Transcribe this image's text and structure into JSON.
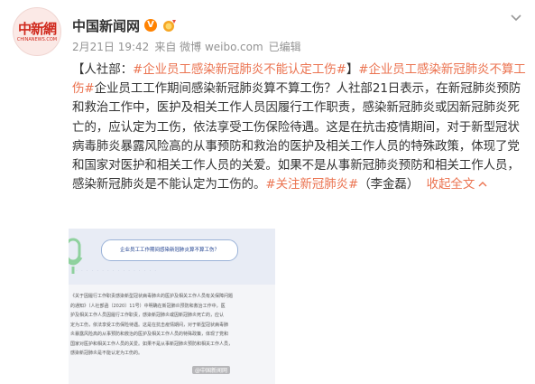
{
  "author": {
    "name": "中国新闻网",
    "avatar_text": "中新網",
    "avatar_subtext": "CHINANEWS.COM"
  },
  "meta": {
    "date": "2月21日 19:42",
    "source": "来自 微博 weibo.com",
    "edited": "已编辑"
  },
  "post": {
    "bracket_open": "【",
    "topic_label": "人社部：",
    "hashtag_1": "#企业员工感染新冠肺炎不能认定工伤#",
    "bracket_close": "】",
    "hashtag_2": "#企业员工感染新冠肺炎不算工伤#",
    "body": "企业员工工作期间感染新冠肺炎算不算工伤？人社部21日表示，在新冠肺炎预防和救治工作中，医护及相关工作人员因履行工作职责，感染新冠肺炎或因新冠肺炎死亡的，应认定为工伤，依法享受工伤保险待遇。这是在抗击疫情期间，对于新型冠状病毒肺炎暴露风险高的从事预防和救治的医护及相关工作人员的特殊政策，体现了党和国家对医护和相关工作人员的关爱。如果不是从事新冠肺炎预防和相关工作人员，感染新冠肺炎是不能认定为工伤的。",
    "hashtag_3": "#关注新冠肺炎#",
    "credit": "（李金磊）",
    "collapse_label": "收起全文",
    "collapse_icon": "chevron-up-icon"
  },
  "image": {
    "bubble_text": "企业员工工作期间感染新冠肺炎算不算工伤？",
    "lines": [
      "《关于因履行工作职责感染新型冠状病毒肺炎的医护及相关工作人员有关保障问题",
      "的通知》（人社部函〔2020〕11号）中明确在新冠肺炎预防和救治工作中，医",
      "护及相关工作人员因履行工作职责，感染新冠肺炎或因新冠肺炎死亡的，应认",
      "定为工伤，依法享受工伤保险待遇。这是在抗击疫情期间，对于新型冠状病毒肺",
      "炎暴露风险高的从事预防和救治的医护及相关工作人员的特殊政策，体现了党和",
      "国家对医护和相关工作人员的关爱。如果不是从事新冠肺炎预防和相关工作人员，",
      "感染新冠肺炎是不能认定为工伤的。"
    ],
    "watermark": "@中国新闻网"
  },
  "colors": {
    "link": "#eb7350",
    "verified": "#ff8200",
    "meta": "#939393"
  }
}
